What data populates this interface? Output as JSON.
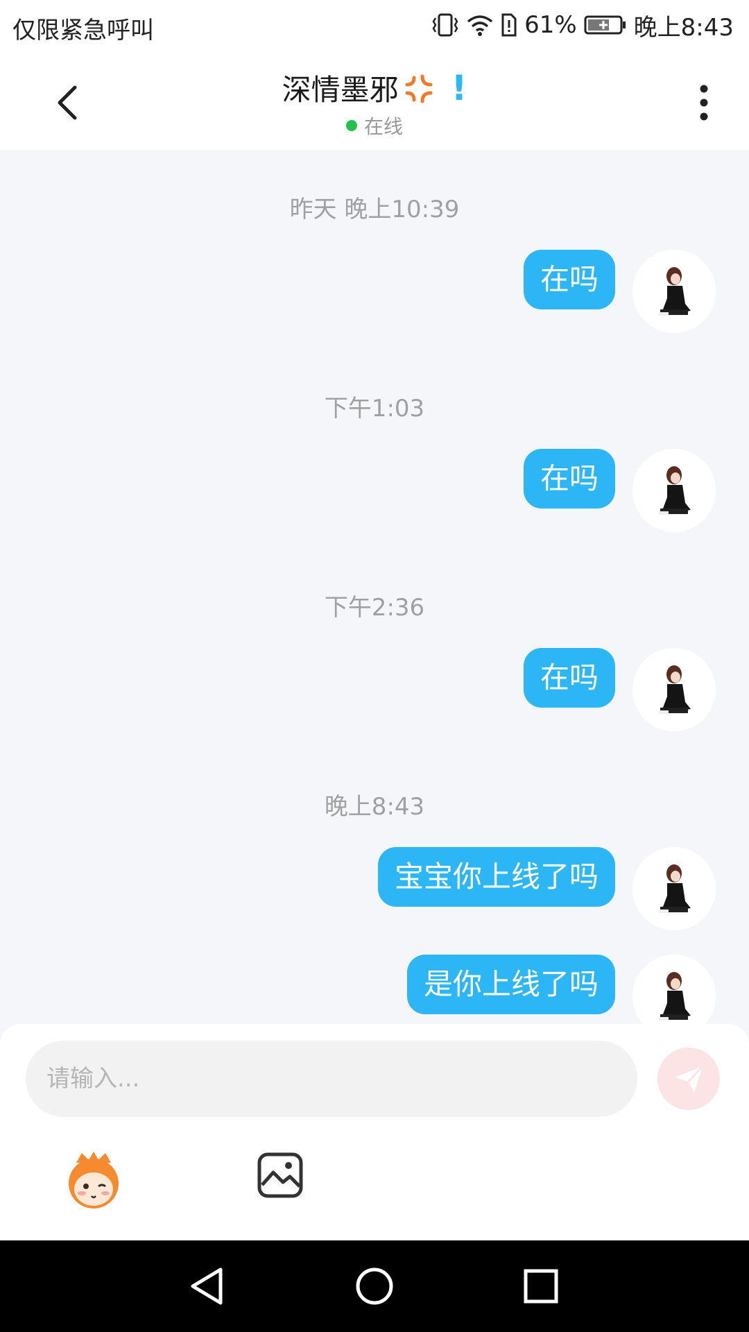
{
  "status_bar": {
    "carrier": "仅限紧急呼叫",
    "battery_percent": "61%",
    "time": "晚上8:43",
    "icons": [
      "vibrate-icon",
      "wifi-icon",
      "sim-alert-icon",
      "battery-charging-icon"
    ]
  },
  "header": {
    "title": "深情墨邪",
    "title_emoji": "anger-icon",
    "title_mark": "!",
    "presence": "在线",
    "presence_color": "#21c24a",
    "icons": [
      "back-icon",
      "more-vert-icon"
    ]
  },
  "chat": {
    "bubble_color": "#2db6f5",
    "timestamps": [
      {
        "text": "昨天 晚上10:39"
      },
      {
        "text": "下午1:03"
      },
      {
        "text": "下午2:36"
      },
      {
        "text": "晚上8:43"
      }
    ],
    "messages": [
      {
        "text": "在吗"
      },
      {
        "text": "在吗"
      },
      {
        "text": "在吗"
      },
      {
        "text": "宝宝你上线了吗"
      },
      {
        "text": "是你上线了吗"
      }
    ]
  },
  "composer": {
    "placeholder": "请输入...",
    "value": "",
    "icons": [
      "send-icon",
      "mascot-emoji-icon",
      "image-icon"
    ]
  },
  "nav_bar": {
    "icons": [
      "nav-back-icon",
      "nav-home-icon",
      "nav-recents-icon"
    ]
  }
}
